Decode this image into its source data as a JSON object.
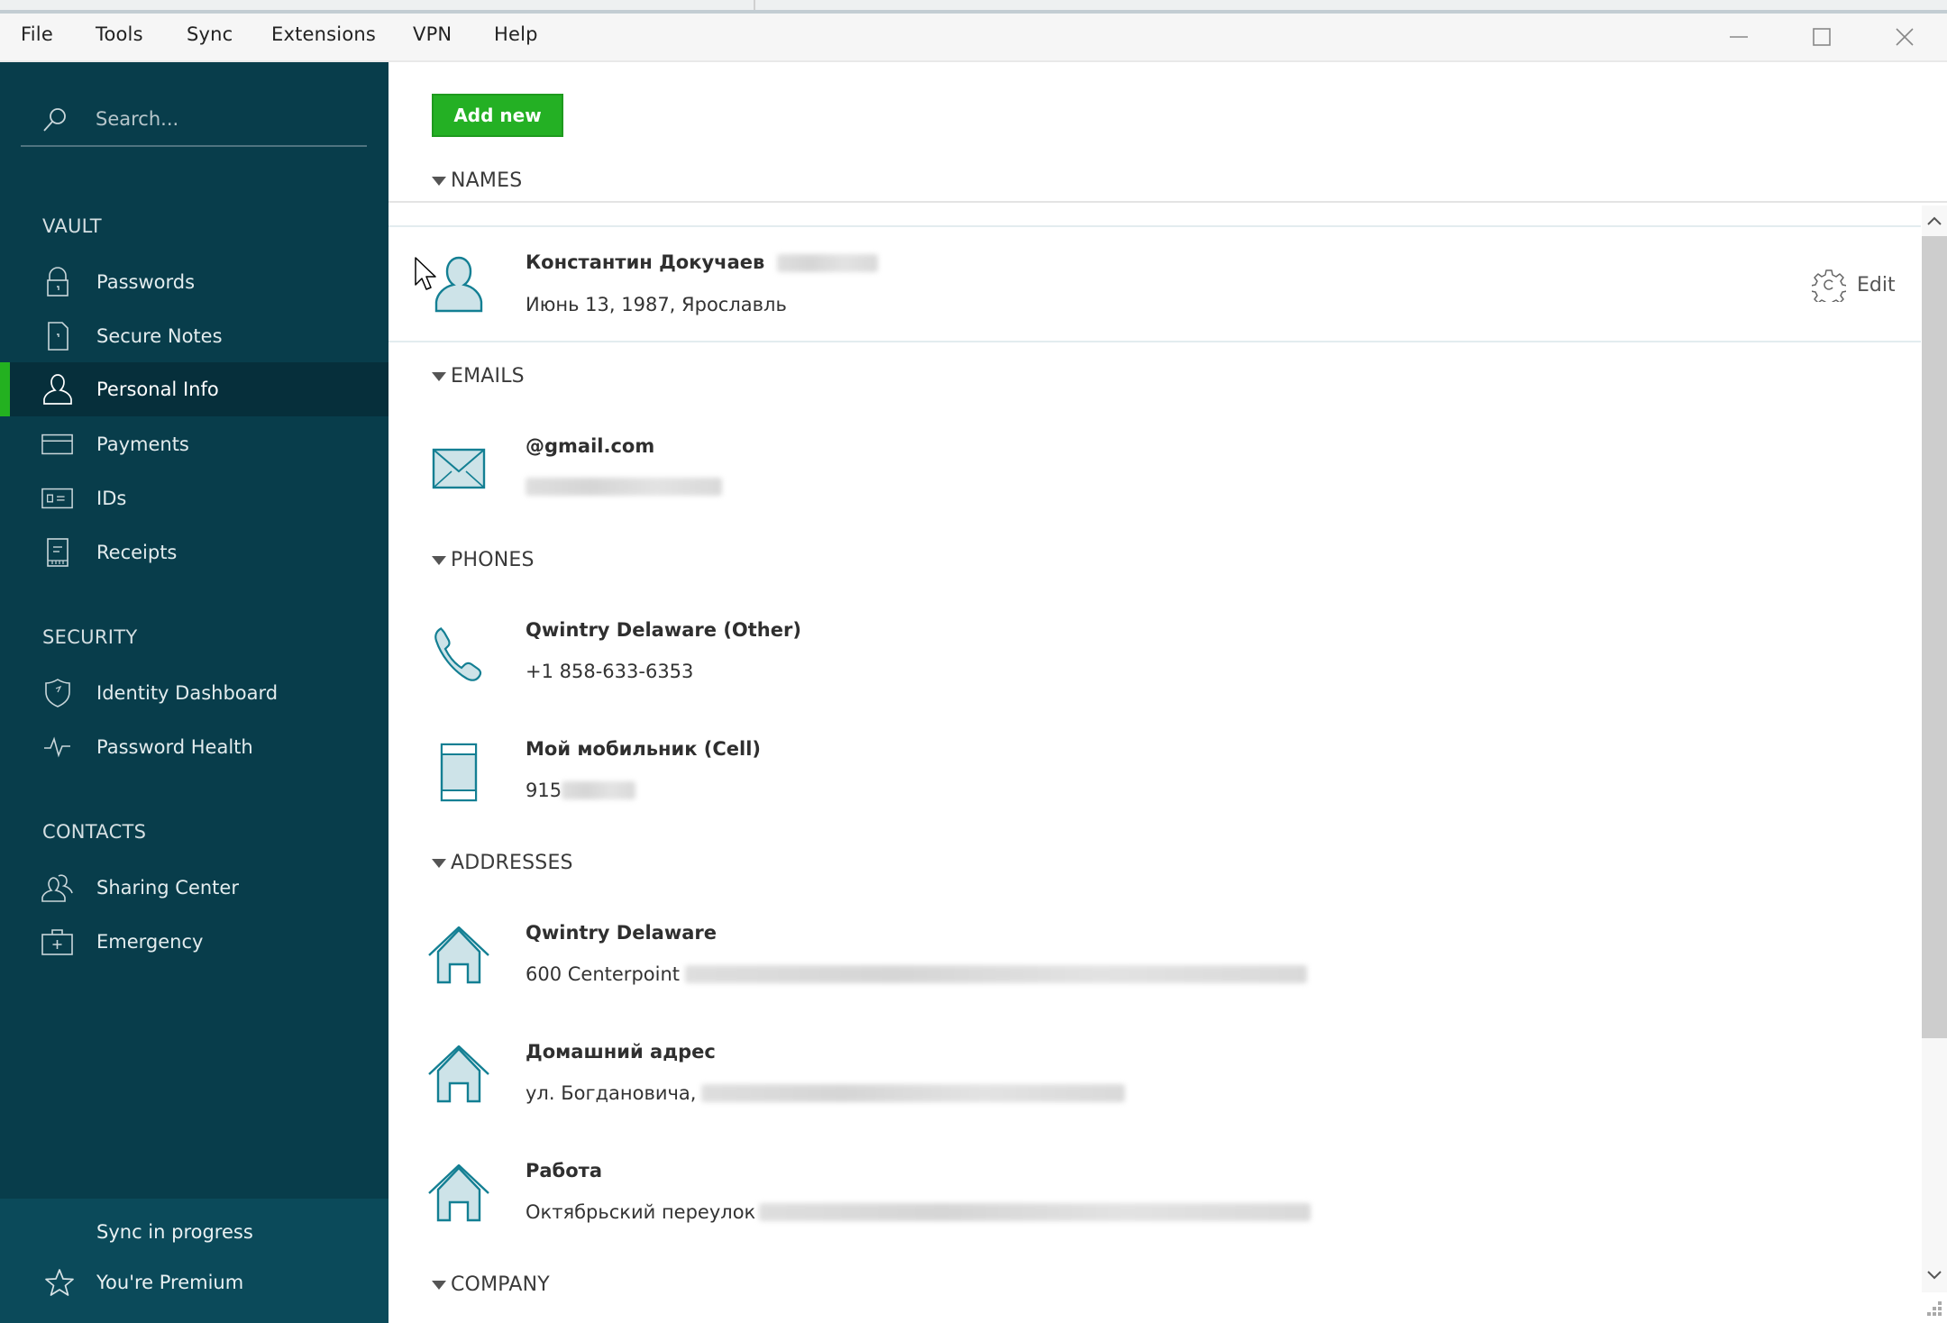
{
  "menu": {
    "items": [
      "File",
      "Tools",
      "Sync",
      "Extensions",
      "VPN",
      "Help"
    ]
  },
  "window_controls": {
    "minimize": "minimize-icon",
    "maximize": "maximize-icon",
    "close": "close-icon"
  },
  "sidebar": {
    "search_placeholder": "Search...",
    "sections": [
      {
        "header": "VAULT",
        "items": [
          {
            "label": "Passwords",
            "icon": "lock-icon"
          },
          {
            "label": "Secure Notes",
            "icon": "note-icon"
          },
          {
            "label": "Personal Info",
            "icon": "person-icon",
            "active": true
          },
          {
            "label": "Payments",
            "icon": "card-icon"
          },
          {
            "label": "IDs",
            "icon": "id-card-icon"
          },
          {
            "label": "Receipts",
            "icon": "receipt-icon"
          }
        ]
      },
      {
        "header": "SECURITY",
        "items": [
          {
            "label": "Identity Dashboard",
            "icon": "shield-icon"
          },
          {
            "label": "Password Health",
            "icon": "pulse-icon"
          }
        ]
      },
      {
        "header": "CONTACTS",
        "items": [
          {
            "label": "Sharing Center",
            "icon": "people-icon"
          },
          {
            "label": "Emergency",
            "icon": "first-aid-kit-icon"
          }
        ]
      }
    ],
    "footer": {
      "sync_status": "Sync in progress",
      "premium_label": "You're Premium",
      "premium_icon": "star-icon"
    }
  },
  "main": {
    "add_new_label": "Add new",
    "edit_label": "Edit",
    "groups": {
      "names": {
        "header": "NAMES",
        "items": [
          {
            "title": "Константин Докучаев",
            "subtitle": "Июнь 13, 1987, Ярославль",
            "icon": "person-icon",
            "redacted_title_suffix": true
          }
        ]
      },
      "emails": {
        "header": "EMAILS",
        "items": [
          {
            "title": "@gmail.com",
            "subtitle": "",
            "icon": "envelope-icon",
            "redacted_subtitle": true
          }
        ]
      },
      "phones": {
        "header": "PHONES",
        "items": [
          {
            "title": "Qwintry Delaware (Other)",
            "subtitle": "+1 858-633-6353",
            "icon": "phone-handset-icon"
          },
          {
            "title": "Мой мобильник (Cell)",
            "subtitle": "915",
            "icon": "mobile-phone-icon",
            "redacted_subtitle": true
          }
        ]
      },
      "addresses": {
        "header": "ADDRESSES",
        "items": [
          {
            "title": "Qwintry Delaware",
            "subtitle": "600 Centerpoint",
            "icon": "house-icon",
            "redacted_subtitle": true
          },
          {
            "title": "Домашний адрес",
            "subtitle": "ул. Богдановича,",
            "icon": "house-icon",
            "redacted_subtitle": true
          },
          {
            "title": "Работа",
            "subtitle": "Октябрьский переулок",
            "icon": "house-icon",
            "redacted_subtitle": true
          }
        ]
      },
      "company": {
        "header": "COMPANY"
      }
    }
  },
  "colors": {
    "sidebar_bg": "#083d4b",
    "sidebar_active_bg": "#062f3b",
    "sidebar_footer_bg": "#0b4a5a",
    "accent_green": "#24b024",
    "icon_teal": "#137f93",
    "icon_fill": "#cde3e8"
  }
}
